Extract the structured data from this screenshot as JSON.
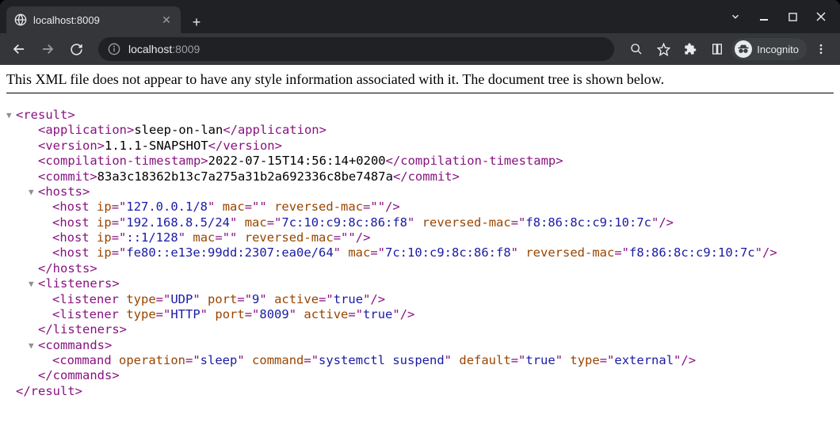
{
  "tab": {
    "title": "localhost:8009"
  },
  "omnibox": {
    "host": "localhost",
    "port": ":8009"
  },
  "incognito_label": "Incognito",
  "xml_notice": "This XML file does not appear to have any style information associated with it. The document tree is shown below.",
  "xml": {
    "root_open": "<result>",
    "root_close": "</result>",
    "application": {
      "open": "<application>",
      "value": "sleep-on-lan",
      "close": "</application>"
    },
    "version": {
      "open": "<version>",
      "value": "1.1.1-SNAPSHOT",
      "close": "</version>"
    },
    "compilation_ts": {
      "open": "<compilation-timestamp>",
      "value": "2022-07-15T14:56:14+0200",
      "close": "</compilation-timestamp>"
    },
    "commit": {
      "open": "<commit>",
      "value": "83a3c18362b13c7a275a31b2a692336c8be7487a",
      "close": "</commit>"
    },
    "hosts_open": "<hosts>",
    "hosts_close": "</hosts>",
    "hosts": [
      {
        "ip": "127.0.0.1/8",
        "mac": "",
        "reversed_mac": ""
      },
      {
        "ip": "192.168.8.5/24",
        "mac": "7c:10:c9:8c:86:f8",
        "reversed_mac": "f8:86:8c:c9:10:7c"
      },
      {
        "ip": "::1/128",
        "mac": "",
        "reversed_mac": ""
      },
      {
        "ip": "fe80::e13e:99dd:2307:ea0e/64",
        "mac": "7c:10:c9:8c:86:f8",
        "reversed_mac": "f8:86:8c:c9:10:7c"
      }
    ],
    "listeners_open": "<listeners>",
    "listeners_close": "</listeners>",
    "listeners": [
      {
        "type": "UDP",
        "port": "9",
        "active": "true"
      },
      {
        "type": "HTTP",
        "port": "8009",
        "active": "true"
      }
    ],
    "commands_open": "<commands>",
    "commands_close": "</commands>",
    "commands": [
      {
        "operation": "sleep",
        "command": "systemctl suspend",
        "default": "true",
        "type": "external"
      }
    ]
  }
}
